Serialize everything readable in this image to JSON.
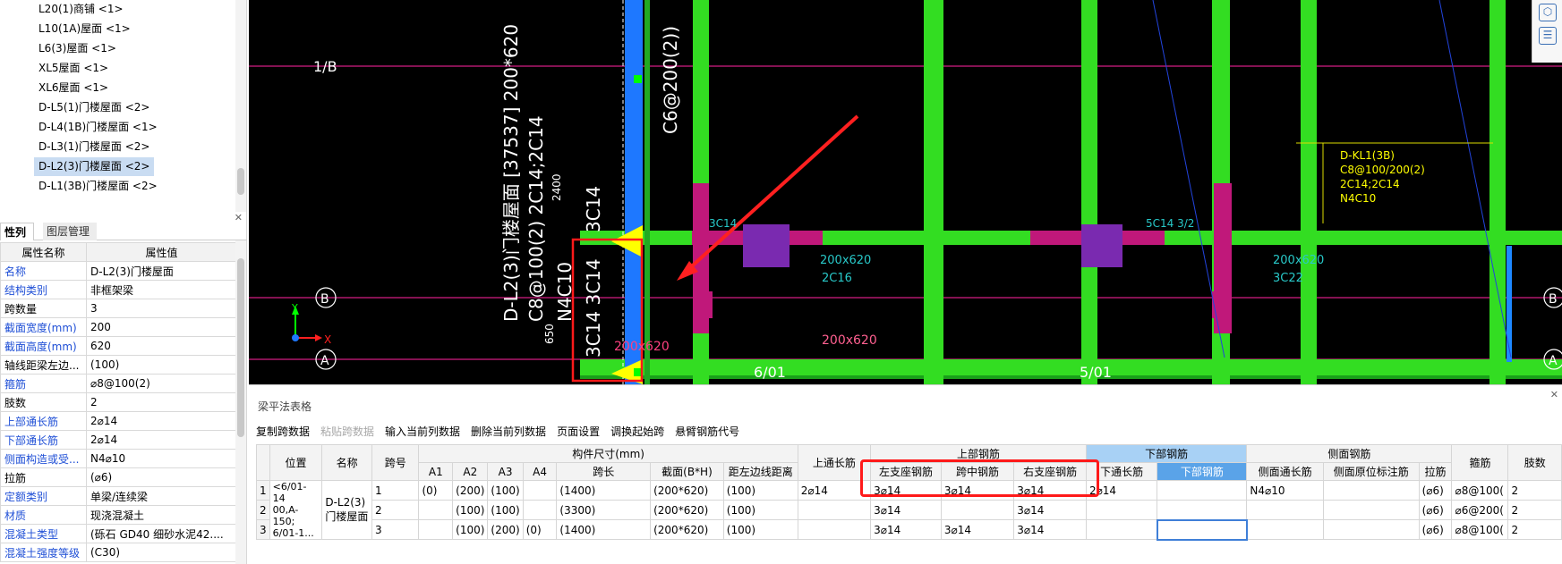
{
  "tree": {
    "items": [
      "L20(1)商铺 <1>",
      "L10(1A)屋面 <1>",
      "L6(3)屋面 <1>",
      "XL5屋面 <1>",
      "XL6屋面 <1>",
      "D-L5(1)门楼屋面 <2>",
      "D-L4(1B)门楼屋面 <1>",
      "D-L3(1)门楼屋面 <2>",
      "D-L2(3)门楼屋面 <2>",
      "D-L1(3B)门楼屋面 <2>"
    ],
    "selected_index": 8
  },
  "props": {
    "tabs": [
      "性列表",
      "图层管理"
    ],
    "col_name": "属性名称",
    "col_value": "属性值",
    "rows": [
      {
        "k": "名称",
        "v": "D-L2(3)门楼屋面",
        "blue": true
      },
      {
        "k": "结构类别",
        "v": "非框架梁",
        "blue": true
      },
      {
        "k": "跨数量",
        "v": "3",
        "blue": false
      },
      {
        "k": "截面宽度(mm)",
        "v": "200",
        "blue": true
      },
      {
        "k": "截面高度(mm)",
        "v": "620",
        "blue": true
      },
      {
        "k": "轴线距梁左边...",
        "v": "(100)",
        "blue": false
      },
      {
        "k": "箍筋",
        "v": "⌀8@100(2)",
        "blue": true
      },
      {
        "k": "肢数",
        "v": "2",
        "blue": false
      },
      {
        "k": "上部通长筋",
        "v": "2⌀14",
        "blue": true
      },
      {
        "k": "下部通长筋",
        "v": "2⌀14",
        "blue": true
      },
      {
        "k": "侧面构造或受...",
        "v": "N4⌀10",
        "blue": true
      },
      {
        "k": "拉筋",
        "v": "(⌀6)",
        "blue": false
      },
      {
        "k": "定额类别",
        "v": "单梁/连续梁",
        "blue": true
      },
      {
        "k": "材质",
        "v": "现浇混凝土",
        "blue": true
      },
      {
        "k": "混凝土类型",
        "v": "(砾石 GD40 细砂水泥42....",
        "blue": true
      },
      {
        "k": "混凝土强度等级",
        "v": "(C30)",
        "blue": true
      }
    ]
  },
  "cad": {
    "axis_labels": {
      "a1b": "1/B",
      "b": "B",
      "a": "A",
      "x601": "6/01",
      "x501": "5/01"
    },
    "axis_xy": {
      "x": "X",
      "y": "Y"
    },
    "vtext1": "D-L2(3)门楼屋面 [37537] 200*620",
    "vtext2": "C8@100(2) 2C14;2C14",
    "vtext3": "N4C10",
    "vtext4": "3C14",
    "vtext5": "3C14 3C14",
    "vtext6": "C6@200(2))",
    "num2400": "2400",
    "num650": "650",
    "dim1": "200x620",
    "dim2": "200x620",
    "dim3": "200x620",
    "dim4": "200x620",
    "note_c16": "2C16",
    "note_c22": "3C22",
    "lbl_kl3b": "D-KL1(3B)",
    "lbl_kl3b2": "C8@100/200(2)",
    "lbl_kl3b3": "2C14;2C14",
    "lbl_kl3b4": "N4C10",
    "lbl_5c14": "5C14 3/2",
    "lbl_3c14": "3C14"
  },
  "bottom": {
    "title": "梁平法表格",
    "toolbar": [
      "复制跨数据",
      "粘贴跨数据",
      "输入当前列数据",
      "删除当前列数据",
      "页面设置",
      "调换起始跨",
      "悬臂钢筋代号"
    ],
    "toolbar_disabled": [
      false,
      true,
      false,
      false,
      false,
      false,
      false
    ],
    "groups": {
      "size": "构件尺寸(mm)",
      "top": "上部钢筋",
      "bottom": "下部钢筋",
      "side": "侧面钢筋"
    },
    "headers": {
      "pos": "位置",
      "name": "名称",
      "span": "跨号",
      "a1": "A1",
      "a2": "A2",
      "a3": "A3",
      "a4": "A4",
      "len": "跨长",
      "sec": "截面(B*H)",
      "dist": "距左边线距离",
      "top_long": "上通长筋",
      "left_sup": "左支座钢筋",
      "mid": "跨中钢筋",
      "right_sup": "右支座钢筋",
      "bot_long": "下通长筋",
      "bot": "下部钢筋",
      "side_long": "侧面通长筋",
      "side_orig": "侧面原位标注筋",
      "tie": "拉筋",
      "stirrup": "箍筋",
      "legs": "肢数"
    },
    "position": "<6/01-14\n00,A-150;\n6/01-1...",
    "name_cell": "D-L2(3)门楼屋面",
    "rows": [
      {
        "rh": "1",
        "span": "1",
        "a1": "(0)",
        "a2": "(200)",
        "a3": "(100)",
        "a4": "",
        "len": "(1400)",
        "sec": "(200*620)",
        "dist": "(100)",
        "top_long": "2⌀14",
        "left": "3⌀14",
        "mid": "3⌀14",
        "right": "3⌀14",
        "bot_long": "2⌀14",
        "bot": "",
        "side_long": "N4⌀10",
        "side_orig": "",
        "tie": "(⌀6)",
        "stirrup": "⌀8@100(",
        "legs": "2"
      },
      {
        "rh": "2",
        "span": "2",
        "a1": "",
        "a2": "(100)",
        "a3": "(100)",
        "a4": "",
        "len": "(3300)",
        "sec": "(200*620)",
        "dist": "(100)",
        "top_long": "",
        "left": "3⌀14",
        "mid": "",
        "right": "3⌀14",
        "bot_long": "",
        "bot": "",
        "side_long": "",
        "side_orig": "",
        "tie": "(⌀6)",
        "stirrup": "⌀6@200(",
        "legs": "2"
      },
      {
        "rh": "3",
        "span": "3",
        "a1": "",
        "a2": "(100)",
        "a3": "(200)",
        "a4": "(0)",
        "len": "(1400)",
        "sec": "(200*620)",
        "dist": "(100)",
        "top_long": "",
        "left": "3⌀14",
        "mid": "3⌀14",
        "right": "3⌀14",
        "bot_long": "",
        "bot": "",
        "side_long": "",
        "side_orig": "",
        "tie": "(⌀6)",
        "stirrup": "⌀8@100(",
        "legs": "2"
      }
    ]
  }
}
